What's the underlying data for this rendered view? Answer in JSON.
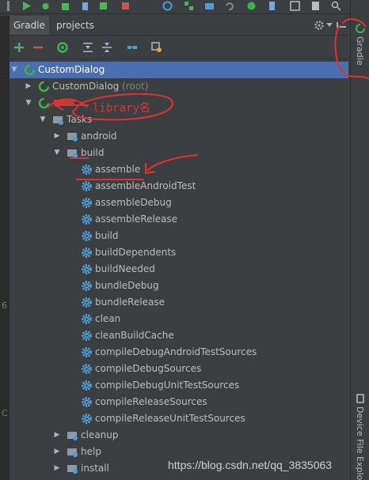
{
  "tabs": [
    {
      "label": "Gradle",
      "active": true
    },
    {
      "label": "projects",
      "active": false
    }
  ],
  "toolbar": {
    "items": [
      "add-icon",
      "remove-icon",
      "refresh-gradle-icon",
      "expand-all-icon",
      "collapse-all-icon",
      "link-icon",
      "settings-icon"
    ]
  },
  "header_controls": {
    "settings": "settings-icon",
    "hide": "hide-panel-icon"
  },
  "tree": {
    "root": {
      "label": "CustomDialog"
    },
    "root_project": {
      "label": "CustomDialog",
      "suffix": "(root)"
    },
    "library_annotation": "library名",
    "tasks": {
      "label": "Tasks"
    },
    "android": {
      "label": "android"
    },
    "build": {
      "label": "build"
    },
    "build_tasks": [
      "assemble",
      "assembleAndroidTest",
      "assembleDebug",
      "assembleRelease",
      "build",
      "buildDependents",
      "buildNeeded",
      "bundleDebug",
      "bundleRelease",
      "clean",
      "cleanBuildCache",
      "compileDebugAndroidTestSources",
      "compileDebugSources",
      "compileDebugUnitTestSources",
      "compileReleaseSources",
      "compileReleaseUnitTestSources"
    ],
    "cleanup": {
      "label": "cleanup"
    },
    "help": {
      "label": "help"
    },
    "install": {
      "label": "install"
    }
  },
  "side_tabs": {
    "gradle": "Gradle",
    "device_file_explorer": "Device File Explo"
  },
  "left_edge": {
    "chars": [
      "6",
      "C"
    ]
  },
  "watermark": "https://blog.csdn.net/qq_3835063",
  "colors": {
    "background": "#3c3f41",
    "selection": "#4b6eaf",
    "annotation": "#e03030",
    "gradle_green": "#3bb54a",
    "gear_blue": "#4a9fdb"
  }
}
